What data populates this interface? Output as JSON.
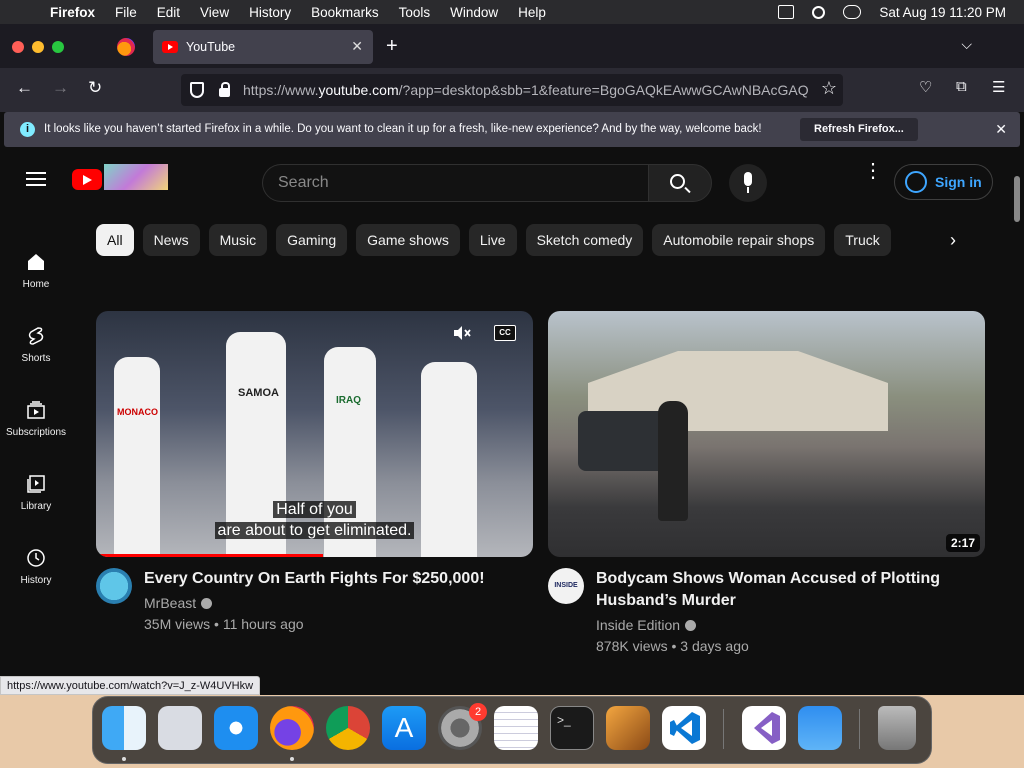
{
  "menubar": {
    "app_name": "Firefox",
    "menus": [
      "File",
      "Edit",
      "View",
      "History",
      "Bookmarks",
      "Tools",
      "Window",
      "Help"
    ],
    "clock": "Sat Aug 19  11:20 PM"
  },
  "browser": {
    "tab_title": "YouTube",
    "url_prefix": "https://www.",
    "url_host": "youtube.com",
    "url_path": "/?app=desktop&sbb=1&feature=BgoGAQkEAwwGCAwNBAcGAQ",
    "notification": {
      "message": "It looks like you haven’t started Firefox in a while. Do you want to clean it up for a fresh, like-new experience? And by the way, welcome back!",
      "button": "Refresh Firefox..."
    },
    "status_url": "https://www.youtube.com/watch?v=J_z-W4UVHkw"
  },
  "youtube": {
    "search_placeholder": "Search",
    "sign_in": "Sign in",
    "chips": [
      "All",
      "News",
      "Music",
      "Gaming",
      "Game shows",
      "Live",
      "Sketch comedy",
      "Automobile repair shops",
      "Truck"
    ],
    "sidebar": [
      {
        "label": "Home",
        "icon": "home-icon"
      },
      {
        "label": "Shorts",
        "icon": "shorts-icon"
      },
      {
        "label": "Subscriptions",
        "icon": "subscriptions-icon"
      },
      {
        "label": "Library",
        "icon": "library-icon"
      },
      {
        "label": "History",
        "icon": "history-icon"
      }
    ],
    "videos": [
      {
        "title": "Every Country On Earth Fights For $250,000!",
        "channel": "MrBeast",
        "views": "35M views",
        "age": "11 hours ago",
        "caption_line1": "Half of you",
        "caption_line2": "are about to get eliminated.",
        "jersey1": "MONACO",
        "jersey2": "SAMOA",
        "jersey3": "IRAQ",
        "watched_fraction": 0.52
      },
      {
        "title": "Bodycam Shows Woman Accused of Plotting Husband’s Murder",
        "channel": "Inside Edition",
        "views": "878K views",
        "age": "3 days ago",
        "duration": "2:17",
        "channel_logo_text": "INSIDE"
      }
    ]
  },
  "dock": {
    "apps": [
      "Finder",
      "Launchpad",
      "Safari",
      "Firefox",
      "Chrome",
      "App Store",
      "System Settings",
      "TextEdit",
      "Terminal",
      "GarageBand",
      "Visual Studio Code",
      "Visual Studio",
      "Weather",
      "Trash"
    ],
    "settings_badge": "2"
  },
  "colors": {
    "youtube_red": "#ff0000",
    "link_blue": "#3ea6ff",
    "firefox_dark": "#1c1b22"
  }
}
